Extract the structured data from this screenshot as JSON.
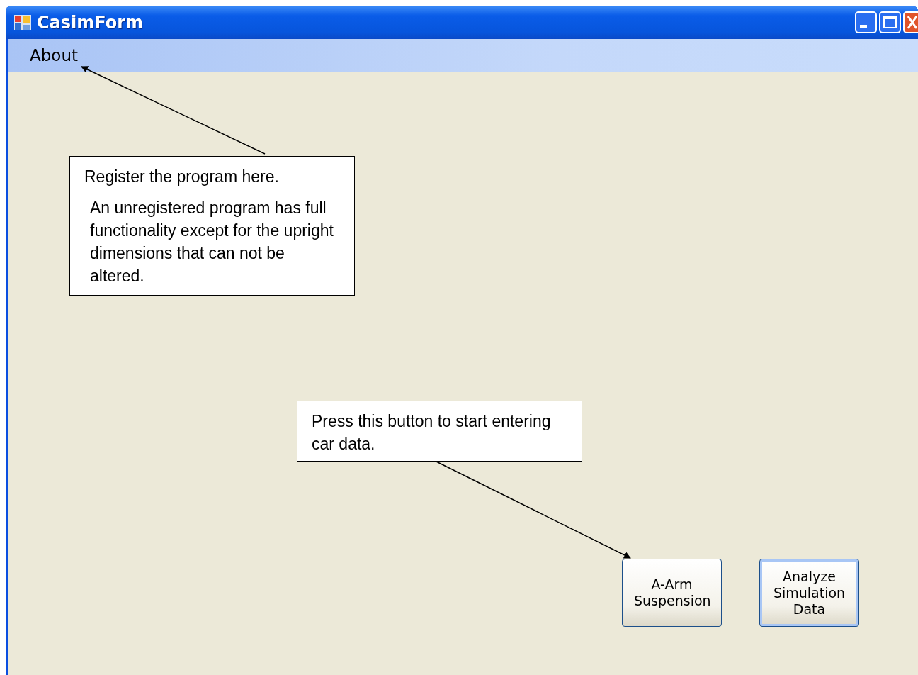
{
  "window": {
    "title": "CasimForm"
  },
  "menu": [
    {
      "label": "About"
    }
  ],
  "callouts": [
    {
      "paragraphs": [
        "Register the program here.",
        "An unregistered program has full functionality except for the upright dimensions that can not be altered."
      ]
    },
    {
      "paragraphs": [
        "Press this button to start entering car data."
      ]
    }
  ],
  "buttons": [
    {
      "label": "A-Arm Suspension",
      "focused": false
    },
    {
      "label": "Analyze Simulation Data",
      "focused": true
    }
  ]
}
